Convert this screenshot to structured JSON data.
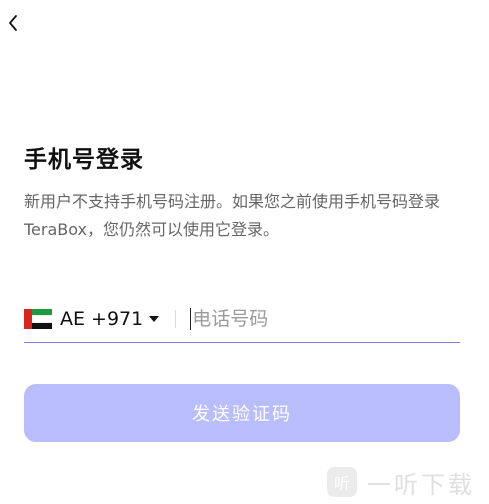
{
  "header": {
    "back_icon": "chevron-left-icon"
  },
  "login": {
    "title": "手机号登录",
    "description": "新用户不支持手机号码注册。如果您之前使用手机号码登录TeraBox，您仍然可以使用它登录。"
  },
  "phone": {
    "country_flag": "uae-flag-icon",
    "country_code": "AE +971",
    "caret_icon": "caret-down-icon",
    "input_value": "",
    "placeholder": "电话号码"
  },
  "actions": {
    "send_code_label": "发送验证码"
  },
  "colors": {
    "accent": "#7b84e6",
    "button_disabled": "#b9bdfb",
    "description_text": "#666666"
  },
  "watermark": {
    "icon": "ting-icon",
    "icon_glyph": "听",
    "text": "一听下载"
  }
}
